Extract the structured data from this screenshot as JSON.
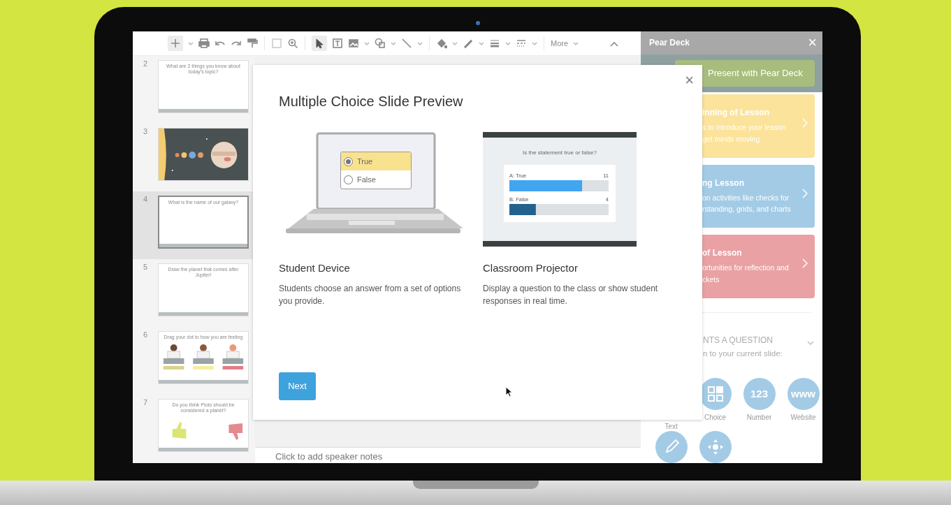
{
  "toolbar": {
    "more_label": "More"
  },
  "slides": [
    {
      "number": "2",
      "kind": "text",
      "text": "What are 2 things you know about today's topic?",
      "selected": false
    },
    {
      "number": "3",
      "kind": "picture",
      "selected": false
    },
    {
      "number": "4",
      "kind": "text",
      "text": "What is the name of our galaxy?",
      "selected": true
    },
    {
      "number": "5",
      "kind": "text",
      "text": "Draw the planet that comes after Jupiter!",
      "selected": false
    },
    {
      "number": "6",
      "kind": "text-picture",
      "text": "Drag your dot to how you are feeling",
      "selected": false
    },
    {
      "number": "7",
      "kind": "text-picture",
      "text": "Do you think Pluto should be considered a planet?",
      "selected": false
    }
  ],
  "speaker_notes": {
    "placeholder": "Click to add speaker notes"
  },
  "sidebar": {
    "title": "Pear Deck",
    "close": "×",
    "present_button": "Present with Pear Deck",
    "cards": [
      {
        "title": "inning of Lesson",
        "lines": [
          "s to introduce your lesson",
          "get minds moving"
        ],
        "color": "#fbe39c"
      },
      {
        "title": "ng Lesson",
        "lines": [
          "on activities like checks for",
          "rstanding, grids, and charts"
        ],
        "color": "#a3cbe5"
      },
      {
        "title": "of Lesson",
        "lines": [
          "ortunities for reflection and",
          "ckets"
        ],
        "color": "#e9a1a3"
      }
    ],
    "section": {
      "title": "NTS A QUESTION",
      "subtitle": "n to your current slide:"
    },
    "question_types": [
      {
        "kind": "covered",
        "label": "Text"
      },
      {
        "kind": "grid",
        "label": "Choice"
      },
      {
        "kind": "glyph",
        "glyph": "123",
        "label": "Number"
      },
      {
        "kind": "glyph",
        "glyph": "www",
        "label": "Website"
      },
      {
        "kind": "pencil"
      },
      {
        "kind": "move"
      }
    ]
  },
  "modal": {
    "title": "Multiple Choice Slide Preview",
    "close": "×",
    "columns": [
      {
        "kind": "device",
        "heading": "Student Device",
        "description": "Students choose an answer from a set of options you provide.",
        "options": [
          {
            "label": "True",
            "selected": true
          },
          {
            "label": "False",
            "selected": false
          }
        ]
      },
      {
        "kind": "projector",
        "heading": "Classroom Projector",
        "description": "Display a question to the class or show student responses in real time.",
        "chart_data": {
          "type": "bar",
          "orientation": "horizontal",
          "title": "Is the statement true or false?",
          "categories": [
            "A: True",
            "B: False"
          ],
          "values": [
            11,
            4
          ],
          "xlim": [
            0,
            15
          ],
          "data_labels": true
        }
      }
    ],
    "next_button": "Next"
  }
}
